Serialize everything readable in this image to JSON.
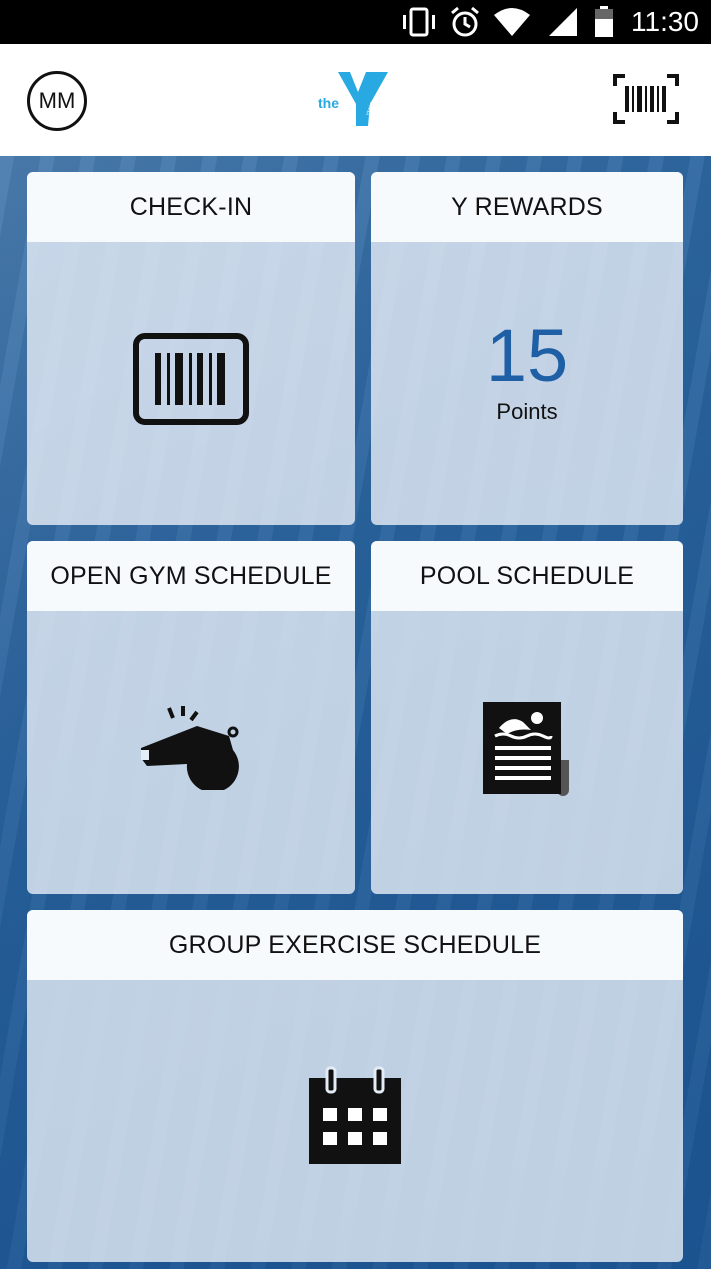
{
  "status_bar": {
    "time": "11:30",
    "icons": [
      "vibrate-icon",
      "alarm-icon",
      "wifi-icon",
      "signal-icon",
      "battery-icon"
    ]
  },
  "header": {
    "avatar_initials": "MM",
    "logo_text": "the",
    "logo_brand": "YMCA",
    "scan_icon": "barcode-scan-icon",
    "brand_color": "#29a9e1"
  },
  "cards": {
    "checkin": {
      "title": "CHECK-IN",
      "icon": "barcode-icon"
    },
    "rewards": {
      "title": "Y REWARDS",
      "points_value": "15",
      "points_label": "Points",
      "value_color": "#1f5fa6"
    },
    "gym": {
      "title": "OPEN GYM SCHEDULE",
      "icon": "whistle-icon"
    },
    "pool": {
      "title": "POOL SCHEDULE",
      "icon": "pool-schedule-icon"
    },
    "group": {
      "title": "GROUP EXERCISE SCHEDULE",
      "icon": "calendar-icon"
    }
  }
}
